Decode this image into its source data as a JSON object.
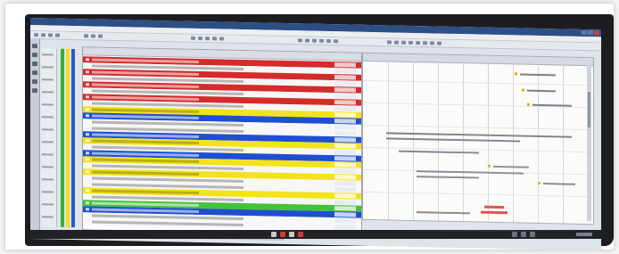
{
  "window": {
    "title": ""
  },
  "menu": {
    "items": [
      "",
      "",
      "",
      "",
      "",
      "",
      "",
      ""
    ]
  },
  "table": {
    "column_headers": [
      "",
      "",
      ""
    ]
  },
  "calendar": {
    "header": ""
  },
  "tabs": [
    "",
    "",
    "",
    "",
    "",
    ""
  ],
  "colors": {
    "row_red": "#d42b2b",
    "row_blue": "#1f4fd1",
    "row_yellow": "#f2e31c",
    "row_green": "#43c23a",
    "row_white": "#f7f7f7",
    "stripe_green": "#34b233",
    "stripe_yellow": "#f0de1a",
    "stripe_blue": "#2a56c9",
    "title_bar": "#2d4f86"
  }
}
